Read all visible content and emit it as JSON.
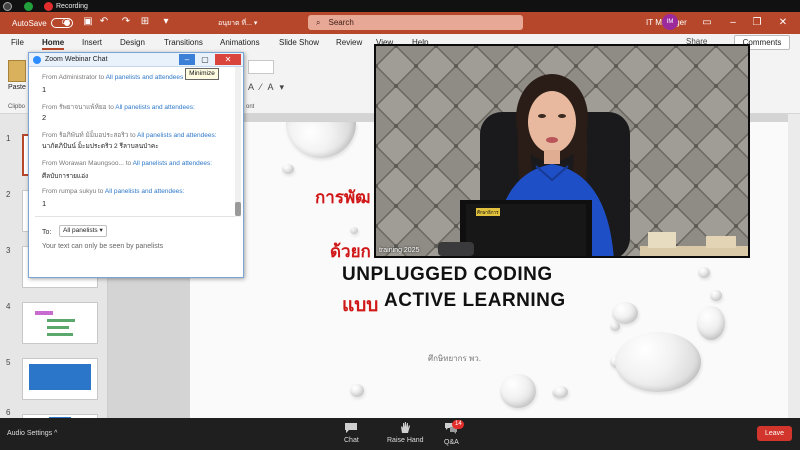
{
  "recording": {
    "label": "Recording"
  },
  "ppt": {
    "titlebar": {
      "autosave_label": "AutoSave",
      "autosave_state": "Off",
      "doc_name": "อนุยาต ที่... ▾",
      "search_placeholder": "Search",
      "user_name": "IT Manager",
      "user_initials": "IM"
    },
    "menu": {
      "items": [
        "File",
        "Home",
        "Insert",
        "Design",
        "Transitions",
        "Animations",
        "Slide Show",
        "Review",
        "View",
        "Help"
      ],
      "active_index": 1,
      "share_label": "Share",
      "comments_label": "Comments"
    },
    "ribbon": {
      "paste_label": "Paste",
      "clipboard_label": "Clipbo",
      "font_label": "ont"
    },
    "thumbnails": {
      "numbers": [
        "1",
        "2",
        "3",
        "4",
        "5",
        "6"
      ],
      "selected_index": 0
    },
    "slide": {
      "line1": "การพัฒ",
      "line2": "ด้วยก",
      "line3": "UNPLUGGED CODING",
      "line4_thai": "แบบ",
      "line4_en": "ACTIVE LEARNING",
      "author": "ศึกษิทยากร พว."
    }
  },
  "chat": {
    "title": "Zoom Webinar Chat",
    "tooltip": "Minimize",
    "messages": [
      {
        "from": "From Administrator to ",
        "to": "All panelists and attendees",
        "text": "1"
      },
      {
        "from": "From รัพยาจนาแพ้ห้ยอ to ",
        "to": "All panelists and attendees:",
        "text": "2"
      },
      {
        "from": "From ร้อภิพันท์  ม้ม็มอประสอริว to ",
        "to": "All panelists and attendees:",
        "text": "นาภัดภิปันน์  ม็ะมประดริว 2 รีลาบลนป่าคะ"
      },
      {
        "from": "From Worawan Maungsoo...  to ",
        "to": "All panelists and attendees:",
        "text": "ศีลบับการายแอ่ง"
      },
      {
        "from": "From rumpa sukyu to ",
        "to": "All panelists and attendees:",
        "text": "1"
      }
    ],
    "to_label": "To:",
    "to_value": "All panelists",
    "input_placeholder": "Your text can only be seen by panelists"
  },
  "video": {
    "caption": "training 2025",
    "nameplate": "ศึกษาธิการ"
  },
  "zoom_toolbar": {
    "audio_settings": "Audio Settings",
    "chat_label": "Chat",
    "raise_hand_label": "Raise Hand",
    "qa_label": "Q&A",
    "qa_badge": "14",
    "leave_label": "Leave"
  },
  "colors": {
    "ppt_accent": "#b7472a",
    "zoom_blue": "#2d8cff",
    "leave_red": "#d1352b",
    "slide_red": "#d01818"
  }
}
